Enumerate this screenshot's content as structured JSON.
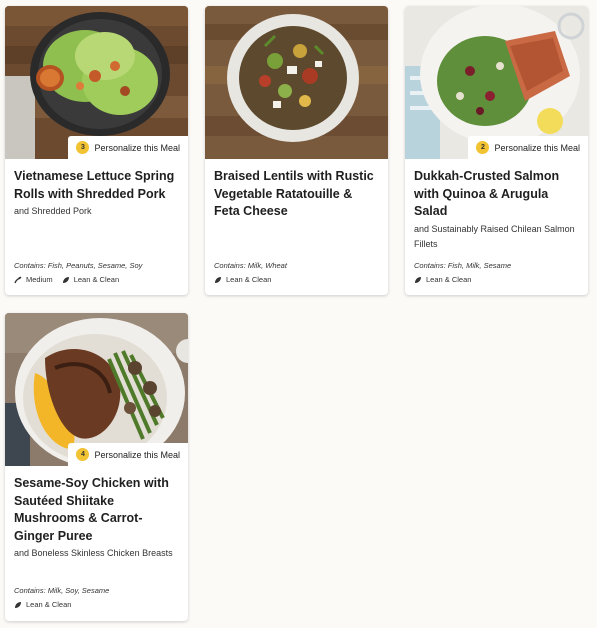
{
  "meals": [
    {
      "title": "Vietnamese Lettuce Spring Rolls with Shredded Pork",
      "subtitle": "and Shredded Pork",
      "contains": "Contains: Fish, Peanuts, Sesame, Soy",
      "personalize_count": "3",
      "personalize_label": "Personalize this Meal",
      "tags": [
        "Medium",
        "Lean & Clean"
      ],
      "tag_icons": [
        "chili-icon",
        "leaf-icon"
      ]
    },
    {
      "title": "Braised Lentils with Rustic Vegetable Ratatouille & Feta Cheese",
      "subtitle": "",
      "contains": "Contains: Milk, Wheat",
      "tags": [
        "Lean & Clean"
      ],
      "tag_icons": [
        "leaf-icon"
      ]
    },
    {
      "title": "Dukkah-Crusted Salmon with Quinoa & Arugula Salad",
      "subtitle": "and Sustainably Raised Chilean Salmon Fillets",
      "contains": "Contains: Fish, Milk, Sesame",
      "personalize_count": "2",
      "personalize_label": "Personalize this Meal",
      "tags": [
        "Lean & Clean"
      ],
      "tag_icons": [
        "leaf-icon"
      ]
    },
    {
      "title": "Sesame-Soy Chicken with Sautéed Shiitake Mushrooms & Carrot-Ginger Puree",
      "subtitle": "and Boneless Skinless Chicken Breasts",
      "contains": "Contains: Milk, Soy, Sesame",
      "personalize_count": "4",
      "personalize_label": "Personalize this Meal",
      "tags": [
        "Lean & Clean"
      ],
      "tag_icons": [
        "leaf-icon"
      ]
    }
  ]
}
